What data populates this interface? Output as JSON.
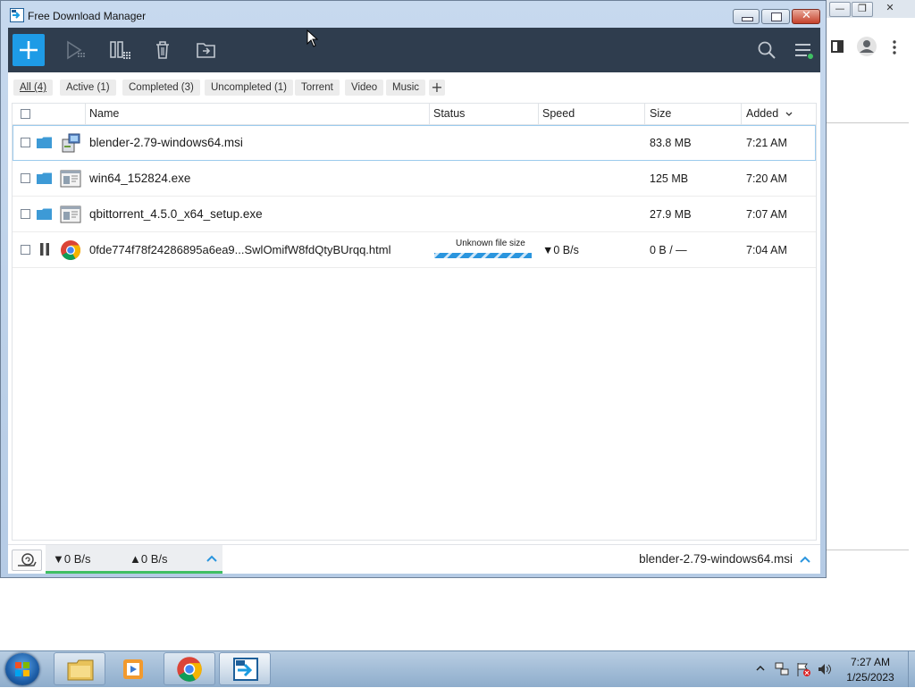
{
  "window": {
    "title": "Free Download Manager"
  },
  "filters": [
    {
      "label": "All (4)"
    },
    {
      "label": "Active (1)"
    },
    {
      "label": "Completed (3)"
    },
    {
      "label": "Uncompleted (1)"
    },
    {
      "label": "Torrent"
    },
    {
      "label": "Video"
    },
    {
      "label": "Music"
    }
  ],
  "columns": {
    "name": "Name",
    "status": "Status",
    "speed": "Speed",
    "size": "Size",
    "added": "Added"
  },
  "downloads": [
    {
      "name": "blender-2.79-windows64.msi",
      "status": "",
      "speed": "",
      "size": "83.8 MB",
      "added": "7:21 AM",
      "icon": "msi-installer-icon"
    },
    {
      "name": "win64_152824.exe",
      "status": "",
      "speed": "",
      "size": "125 MB",
      "added": "7:20 AM",
      "icon": "exe-file-icon"
    },
    {
      "name": "qbittorrent_4.5.0_x64_setup.exe",
      "status": "",
      "speed": "",
      "size": "27.9 MB",
      "added": "7:07 AM",
      "icon": "exe-file-icon"
    },
    {
      "name": "0fde774f78f24286895a6ea9...SwlOmifW8fdQtyBUrqq.html",
      "status": "Unknown file size",
      "speed": "0 B/s",
      "size": "0 B / —",
      "added": "7:04 AM",
      "icon": "chrome-icon"
    }
  ],
  "status_bar": {
    "download_speed": "0 B/s",
    "upload_speed": "0 B/s",
    "selected_file": "blender-2.79-windows64.msi"
  },
  "taskbar": {
    "time": "7:27 AM",
    "date": "1/25/2023"
  },
  "colors": {
    "accent": "#1e9be6",
    "toolbar": "#2f3d4e",
    "speed_ok": "#3fbf63"
  }
}
